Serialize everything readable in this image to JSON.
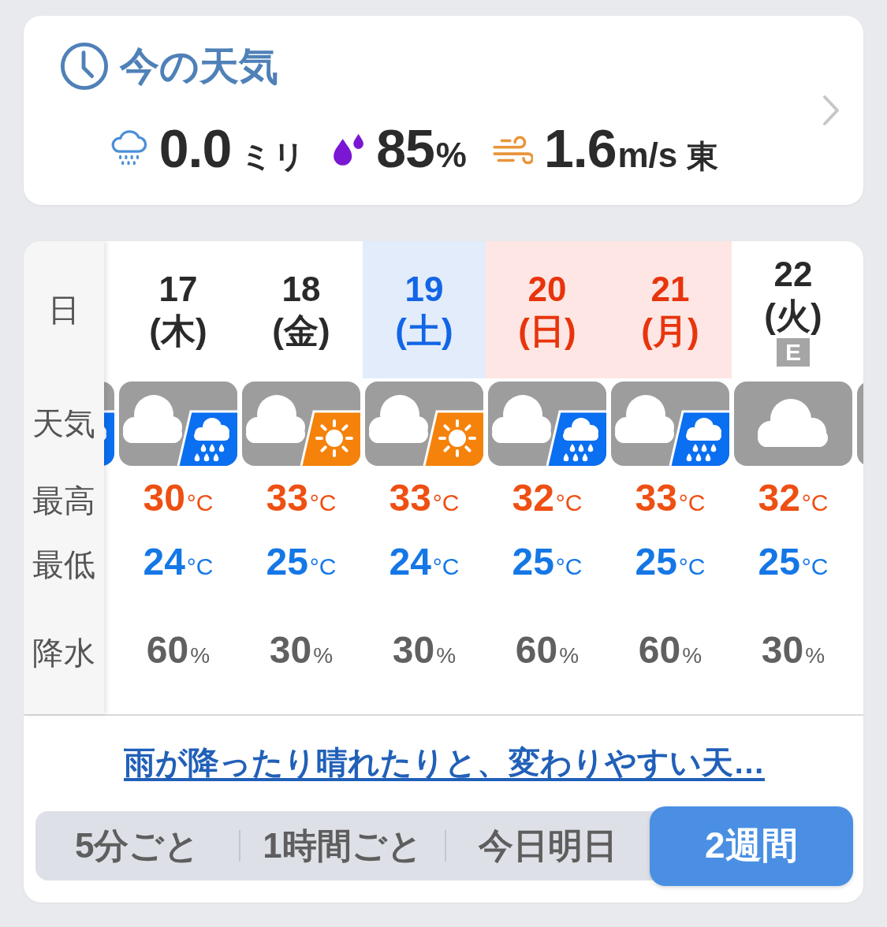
{
  "current": {
    "title": "今の天気",
    "precipitation": {
      "value": "0.0",
      "unit": "ミリ"
    },
    "humidity": {
      "value": "85",
      "unit": "%"
    },
    "wind": {
      "value": "1.6",
      "unit": "m/s",
      "direction": "東"
    }
  },
  "forecast": {
    "row_labels": [
      "日",
      "天気",
      "最高",
      "最低",
      "降水"
    ],
    "clipped_tiles": [
      {
        "kind": "cloud_rain"
      },
      {
        "kind": "cloudy"
      }
    ],
    "days": [
      {
        "date": "17",
        "weekday": "(木)",
        "saturday": false,
        "holiday": false,
        "kind": "cloud_rain",
        "high": {
          "value": "30",
          "unit": "°C"
        },
        "low": {
          "value": "24",
          "unit": "°C"
        },
        "precipitation": {
          "value": "60",
          "unit": "%"
        }
      },
      {
        "date": "18",
        "weekday": "(金)",
        "saturday": false,
        "holiday": false,
        "kind": "cloud_sun",
        "high": {
          "value": "33",
          "unit": "°C"
        },
        "low": {
          "value": "25",
          "unit": "°C"
        },
        "precipitation": {
          "value": "30",
          "unit": "%"
        }
      },
      {
        "date": "19",
        "weekday": "(土)",
        "saturday": true,
        "holiday": false,
        "kind": "cloud_sun",
        "high": {
          "value": "33",
          "unit": "°C"
        },
        "low": {
          "value": "24",
          "unit": "°C"
        },
        "precipitation": {
          "value": "30",
          "unit": "%"
        }
      },
      {
        "date": "20",
        "weekday": "(日)",
        "saturday": false,
        "holiday": true,
        "kind": "cloud_rain",
        "high": {
          "value": "32",
          "unit": "°C"
        },
        "low": {
          "value": "25",
          "unit": "°C"
        },
        "precipitation": {
          "value": "60",
          "unit": "%"
        }
      },
      {
        "date": "21",
        "weekday": "(月)",
        "saturday": false,
        "holiday": true,
        "kind": "cloud_rain",
        "high": {
          "value": "33",
          "unit": "°C"
        },
        "low": {
          "value": "25",
          "unit": "°C"
        },
        "precipitation": {
          "value": "60",
          "unit": "%"
        }
      },
      {
        "date": "22",
        "weekday": "(火)",
        "saturday": false,
        "holiday": false,
        "badge": "E",
        "kind": "cloudy",
        "high": {
          "value": "32",
          "unit": "°C"
        },
        "low": {
          "value": "25",
          "unit": "°C"
        },
        "precipitation": {
          "value": "30",
          "unit": "%"
        }
      }
    ]
  },
  "summary_link": "雨が降ったり晴れたりと、変わりやすい天…",
  "view_tabs": [
    {
      "label": "5分ごと",
      "selected": false
    },
    {
      "label": "1時間ごと",
      "selected": false
    },
    {
      "label": "今日明日",
      "selected": false
    },
    {
      "label": "2週間",
      "selected": true
    }
  ]
}
